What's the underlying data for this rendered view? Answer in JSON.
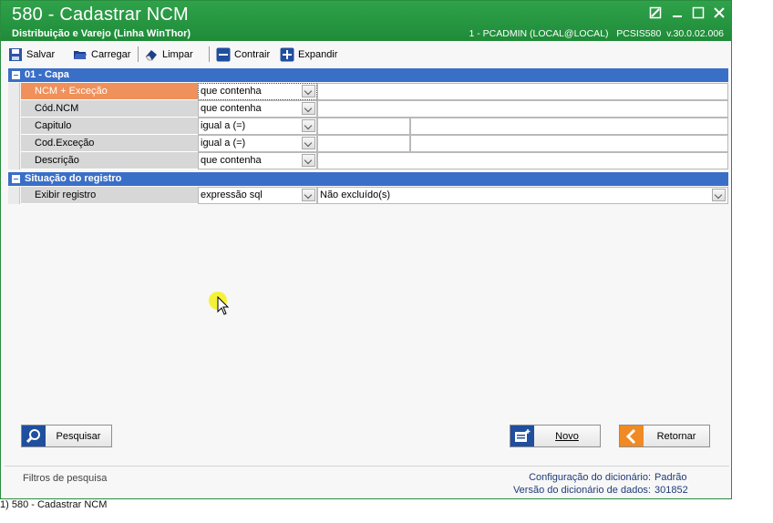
{
  "window": {
    "title": "580 - Cadastrar  NCM",
    "subtitle": "Distribuição e Varejo (Linha WinThor)",
    "session": "1 - PCADMIN (LOCAL@LOCAL)   PCSIS580  v.30.0.02.006"
  },
  "toolbar": {
    "save_label": "Salvar",
    "load_label": "Carregar",
    "clear_label": "Limpar",
    "collapse_label": "Contrair",
    "expand_label": "Expandir"
  },
  "sections": [
    {
      "title": "01 - Capa"
    },
    {
      "title": "Situação do registro"
    }
  ],
  "rows": [
    {
      "label": "NCM + Exceção",
      "operator": "que contenha",
      "value": ""
    },
    {
      "label": "Cód.NCM",
      "operator": "que contenha",
      "value": ""
    },
    {
      "label": "Capitulo",
      "operator": "igual a (=)",
      "value": "",
      "value2": ""
    },
    {
      "label": "Cod.Exceção",
      "operator": "igual a (=)",
      "value": "",
      "value2": ""
    },
    {
      "label": "Descrição",
      "operator": "que contenha",
      "value": ""
    },
    {
      "label": "Exibir registro",
      "operator": "expressão sql",
      "value": "Não excluído(s)"
    }
  ],
  "buttons": {
    "search_label": "Pesquisar",
    "new_label": "Novo",
    "return_label": "Retornar"
  },
  "status": {
    "filters_label": "Filtros de pesquisa",
    "dict_config_label": "Configuração do dicionário:",
    "dict_config_value": "Padrão",
    "dict_version_label": "Versão do dicionário de dados:",
    "dict_version_value": "301852"
  },
  "taskbar": {
    "item_label": "1)  580 - Cadastrar  NCM"
  },
  "colors": {
    "titlebar": "#1f8b39",
    "section_header": "#3a6fc8",
    "active_row": "#f0905a",
    "status_text": "#1f3b78"
  }
}
